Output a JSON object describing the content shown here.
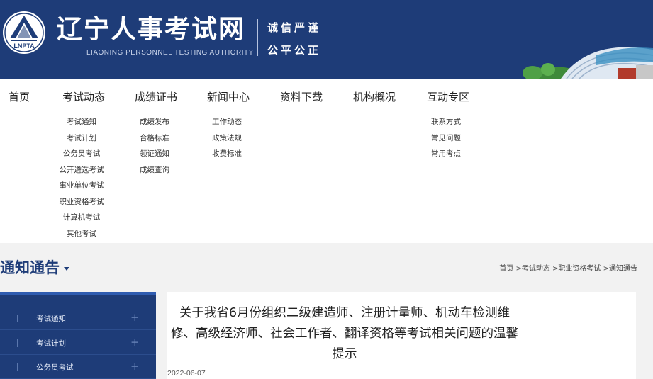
{
  "header": {
    "logo_text": "LNPTA",
    "title": "辽宁人事考试网",
    "subtitle": "LIAONING PERSONNEL TESTING AUTHORITY",
    "motto_line1": "诚信严谨",
    "motto_line2": "公平公正"
  },
  "nav": {
    "items": [
      {
        "label": "首页",
        "sub": []
      },
      {
        "label": "考试动态",
        "sub": [
          "考试通知",
          "考试计划",
          "公务员考试",
          "公开遴选考试",
          "事业单位考试",
          "职业资格考试",
          "计算机考试",
          "其他考试"
        ]
      },
      {
        "label": "成绩证书",
        "sub": [
          "成绩发布",
          "合格标准",
          "领证通知",
          "成绩查询"
        ]
      },
      {
        "label": "新闻中心",
        "sub": [
          "工作动态",
          "政策法规",
          "收费标准"
        ]
      },
      {
        "label": "资料下载",
        "sub": []
      },
      {
        "label": "机构概况",
        "sub": []
      },
      {
        "label": "互动专区",
        "sub": [
          "联系方式",
          "常见问题",
          "常用考点"
        ]
      }
    ]
  },
  "section": {
    "title": "通知通告",
    "breadcrumb": [
      "首页",
      ">考试动态",
      ">职业资格考试",
      ">通知通告"
    ]
  },
  "sidebar": {
    "items": [
      "考试通知",
      "考试计划",
      "公务员考试"
    ],
    "plus": "+"
  },
  "article": {
    "title": "关于我省6月份组织二级建造师、注册计量师、机动车检测维修、高级经济师、社会工作者、翻译资格等考试相关问题的温馨提示",
    "date": "2022-06-07"
  },
  "colors": {
    "brand_blue": "#1e3c78",
    "accent_blue": "#2f5cb0"
  }
}
